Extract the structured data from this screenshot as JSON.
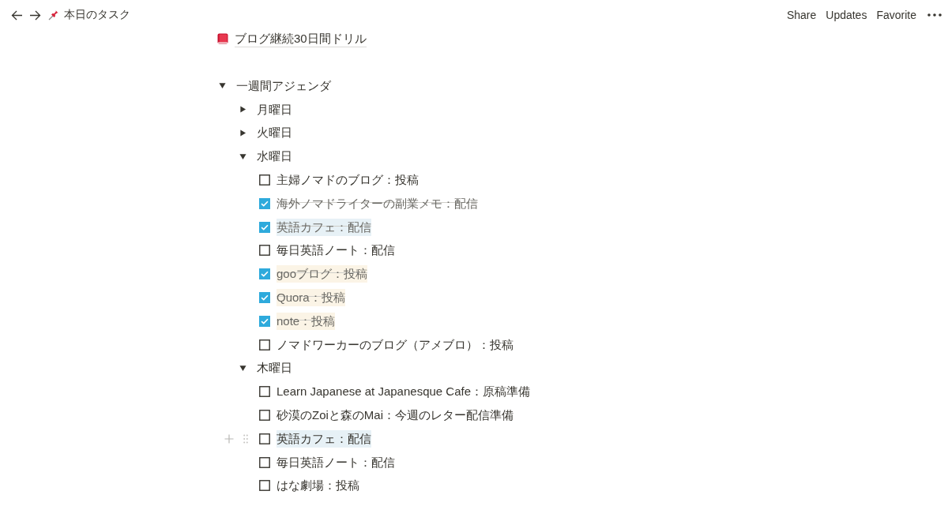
{
  "topbar": {
    "breadcrumb": "本日のタスク",
    "actions": [
      "Share",
      "Updates",
      "Favorite"
    ]
  },
  "blocks": [
    {
      "kind": "page_link",
      "title": "ブログ継続30日間ドリル"
    },
    {
      "kind": "toggle",
      "label": "一週間アジェンダ",
      "expanded": true,
      "children": [
        {
          "kind": "toggle",
          "label": "月曜日",
          "expanded": false
        },
        {
          "kind": "toggle",
          "label": "火曜日",
          "expanded": false
        },
        {
          "kind": "toggle",
          "label": "水曜日",
          "expanded": true,
          "children": [
            {
              "kind": "todo",
              "label": "主婦ノマドのブログ：投稿",
              "checked": false
            },
            {
              "kind": "todo",
              "label": "海外ノマドライターの副業メモ：配信",
              "checked": true
            },
            {
              "kind": "todo",
              "label": "英語カフェ：配信",
              "checked": true,
              "color": "#e7f1f6"
            },
            {
              "kind": "todo",
              "label": "毎日英語ノート：配信",
              "checked": false
            },
            {
              "kind": "todo",
              "label": "gooブログ：投稿",
              "checked": true,
              "color": "#fbf4e6"
            },
            {
              "kind": "todo",
              "label": "Quora：投稿",
              "checked": true,
              "color": "#fbf4e6"
            },
            {
              "kind": "todo",
              "label": "note：投稿",
              "checked": true,
              "color": "#fbf4e6"
            },
            {
              "kind": "todo",
              "label": "ノマドワーカーのブログ（アメブロ）：投稿",
              "checked": false
            }
          ]
        },
        {
          "kind": "toggle",
          "label": "木曜日",
          "expanded": true,
          "children": [
            {
              "kind": "todo",
              "label": "Learn Japanese at Japanesque Cafe：原稿準備",
              "checked": false
            },
            {
              "kind": "todo",
              "label": "砂漠のZoiと森のMai：今週のレター配信準備",
              "checked": false
            },
            {
              "kind": "todo",
              "label": "英語カフェ：配信",
              "checked": false,
              "color": "#e7f1f6",
              "hovered": true
            },
            {
              "kind": "todo",
              "label": "毎日英語ノート：配信",
              "checked": false
            },
            {
              "kind": "todo",
              "label": "はな劇場：投稿",
              "checked": false
            }
          ]
        }
      ]
    }
  ]
}
